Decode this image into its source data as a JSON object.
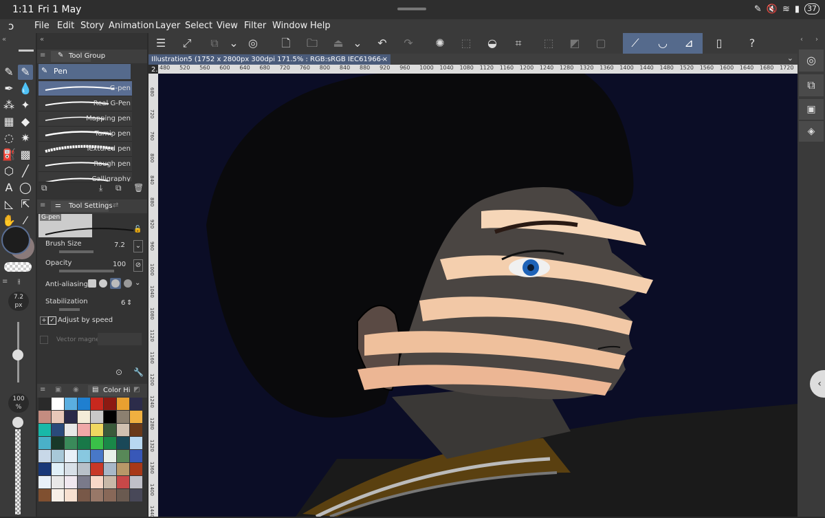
{
  "status_bar": {
    "time": "1:11",
    "date": "Fri 1 May",
    "battery": "37"
  },
  "menu": {
    "items": [
      "File",
      "Edit",
      "Story",
      "Animation",
      "Layer",
      "Select",
      "View",
      "Filter",
      "Window",
      "Help"
    ]
  },
  "document": {
    "tab_title": "Illustration5 (1752 x 2800px 300dpi 171.5% : RGB:sRGB IEC61966-2.1)"
  },
  "ruler": {
    "top_ticks": [
      "480",
      "520",
      "560",
      "600",
      "640",
      "680",
      "720",
      "760",
      "800",
      "840",
      "880",
      "920",
      "960",
      "1000",
      "1040",
      "1080",
      "1120",
      "1160",
      "1200",
      "1240",
      "1280",
      "1320",
      "1360",
      "1400",
      "1440",
      "1480",
      "1520",
      "1560",
      "1600",
      "1640",
      "1680",
      "1720"
    ],
    "left_ticks": [
      "680",
      "720",
      "760",
      "800",
      "840",
      "880",
      "920",
      "960",
      "1000",
      "1040",
      "1080",
      "1120",
      "1160",
      "1200",
      "1240",
      "1280",
      "1320",
      "1360",
      "1400",
      "1440"
    ]
  },
  "tool_group": {
    "title": "Tool Group",
    "active_tool": "Pen",
    "brushes": [
      "G-pen",
      "Real G-Pen",
      "Mapping pen",
      "Turnip pen",
      "Textured pen",
      "Rough pen",
      "Calligraphy"
    ],
    "selected_brush": "G-pen"
  },
  "tool_settings": {
    "title": "Tool Settings",
    "preset_name": "G-pen",
    "brush_size_label": "Brush Size",
    "brush_size_value": "7.2",
    "opacity_label": "Opacity",
    "opacity_value": "100",
    "antialiasing_label": "Anti-aliasing",
    "stabilization_label": "Stabilization",
    "stabilization_value": "6",
    "adjust_by_speed_label": "Adjust by speed",
    "vector_magnet_label": "Vector magnet"
  },
  "size_indicator": {
    "value": "7.2",
    "unit": "px"
  },
  "opacity_indicator": {
    "value": "100",
    "unit": "%"
  },
  "color_panel": {
    "title": "Color Hi"
  },
  "colors": {
    "main_color": "#1d1d1d",
    "sub_color": "#8a7a7a",
    "accent": "#556a8c",
    "canvas_bg": "#0b0d26",
    "palette": [
      "#2a2a2a",
      "#ffffff",
      "#5aaee0",
      "#1f7fd0",
      "#c8281e",
      "#8c1a12",
      "#e8a030",
      "#2c2c4a",
      "#c48c80",
      "#e8c8b8",
      "#2a2a48",
      "#f4ecd8",
      "#c8c8c8",
      "#000000",
      "#8c8070",
      "#f0b040",
      "#18b8a8",
      "#2a4a7a",
      "#e8e8e8",
      "#f0a8a8",
      "#f0d860",
      "#3a5a3a",
      "#d0c0b0",
      "#6a3a1a",
      "#4ab0c8",
      "#183828",
      "#3a8a5a",
      "#187848",
      "#3ac048",
      "#1a8848",
      "#1a4858",
      "#b8d8f0",
      "#c8d8e8",
      "#a8c8d8",
      "#e8f0f8",
      "#88c8e0",
      "#4878c8",
      "#e8f0e8",
      "#588858",
      "#3858b8",
      "#183878",
      "#e0f0f8",
      "#d8e0e8",
      "#b8c0c8",
      "#c83828",
      "#a8b8c8",
      "#b89868",
      "#a83818",
      "#e8f0f8",
      "#e8e8e8",
      "#f0e8f0",
      "#7a7a8a",
      "#f8d8c8",
      "#c8b8a8",
      "#c84848",
      "#c0c0c8",
      "#805030",
      "#f8f0e8",
      "#f8e0d0",
      "#785848",
      "#987868",
      "#886858",
      "#6a5a50",
      "#484858"
    ]
  }
}
